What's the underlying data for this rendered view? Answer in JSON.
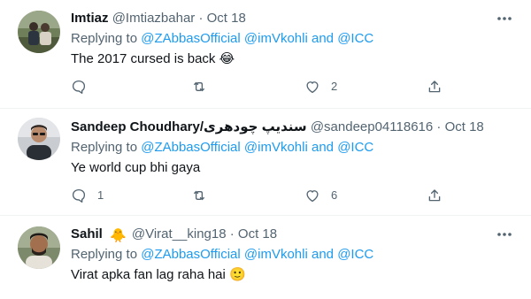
{
  "tweets": [
    {
      "name": "Imtiaz",
      "handle": "@Imtiazbahar",
      "separator": "·",
      "date": "Oct 18",
      "replying_prefix": "Replying to",
      "mention_1": "@ZAbbasOfficial",
      "mention_2": "@imVkohli",
      "replying_and": "and",
      "mention_3": "@ICC",
      "text": "The 2017 cursed is back",
      "text_emoji": "😂",
      "reply_count": "",
      "retweet_count": "",
      "like_count": "2",
      "avatar_icon": "avatar-two-men-outdoors"
    },
    {
      "name": "Sandeep Choudhary/سندیپ چودھری",
      "handle": "@sandeep04118616",
      "separator": "·",
      "date": "Oct 18",
      "replying_prefix": "Replying to",
      "mention_1": "@ZAbbasOfficial",
      "mention_2": "@imVkohli",
      "replying_and": "and",
      "mention_3": "@ICC",
      "text": "Ye world cup bhi gaya",
      "text_emoji": "",
      "reply_count": "1",
      "retweet_count": "",
      "like_count": "6",
      "avatar_icon": "avatar-man-sunglasses"
    },
    {
      "name": "Sahil",
      "name_emoji": "🐥",
      "handle": "@Virat__king18",
      "separator": "·",
      "date": "Oct 18",
      "replying_prefix": "Replying to",
      "mention_1": "@ZAbbasOfficial",
      "mention_2": "@imVkohli",
      "replying_and": "and",
      "mention_3": "@ICC",
      "text": "Virat apka fan lag raha hai",
      "text_emoji": "🙂",
      "reply_count": "",
      "retweet_count": "",
      "like_count": "",
      "avatar_icon": "avatar-man-beard"
    }
  ],
  "icons": {
    "reply": "reply-icon",
    "retweet": "retweet-icon",
    "like": "like-icon",
    "share": "share-icon",
    "more": "more-icon"
  },
  "colors": {
    "link": "#1d9bf0",
    "secondary": "#536471",
    "primary": "#0f1419",
    "divider": "#eff3f4"
  }
}
